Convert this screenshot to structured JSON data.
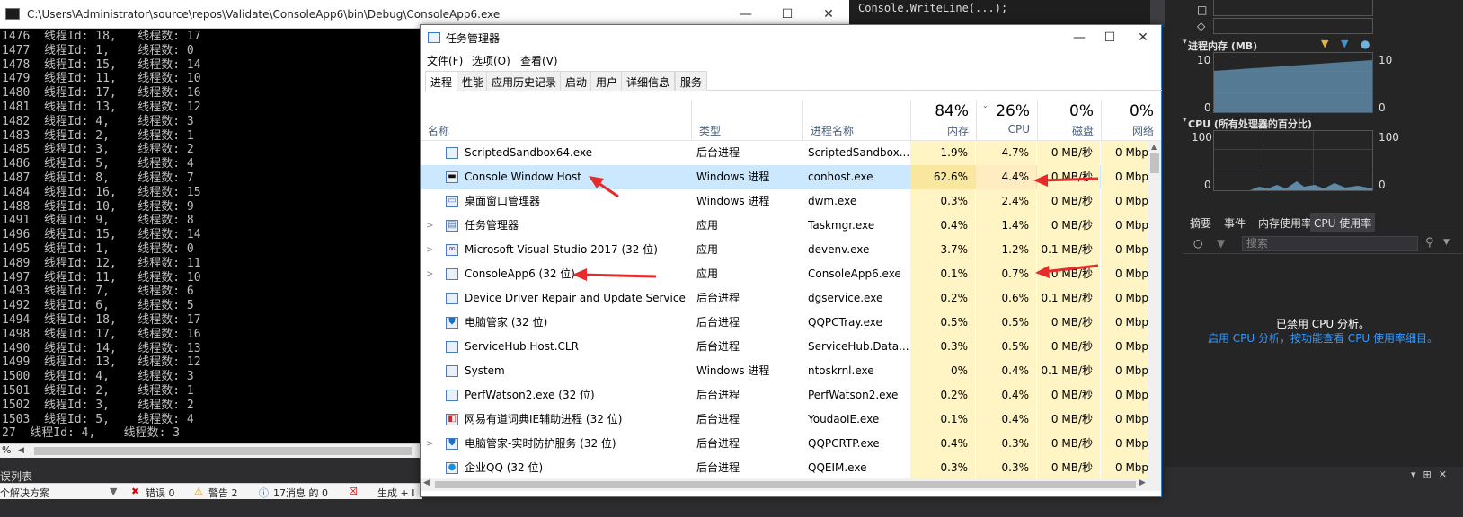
{
  "ide": {
    "top_code_fragment": "Console.WriteLine(...);",
    "error_list_title": "误列表",
    "errbar": {
      "solution": "个解决方案",
      "errors": "错误 0",
      "warnings": "警告 2",
      "messages": "17消息 的 0",
      "build": "生成 + I"
    }
  },
  "console": {
    "title": "C:\\Users\\Administrator\\source\\repos\\Validate\\ConsoleApp6\\bin\\Debug\\ConsoleApp6.exe",
    "lines": [
      "1476  线程Id: 18,   线程数: 17",
      "1477  线程Id: 1,    线程数: 0",
      "1478  线程Id: 15,   线程数: 14",
      "1479  线程Id: 11,   线程数: 10",
      "1480  线程Id: 17,   线程数: 16",
      "1481  线程Id: 13,   线程数: 12",
      "1482  线程Id: 4,    线程数: 3",
      "1483  线程Id: 2,    线程数: 1",
      "1485  线程Id: 3,    线程数: 2",
      "1486  线程Id: 5,    线程数: 4",
      "1487  线程Id: 8,    线程数: 7",
      "1484  线程Id: 16,   线程数: 15",
      "1488  线程Id: 10,   线程数: 9",
      "1491  线程Id: 9,    线程数: 8",
      "1496  线程Id: 15,   线程数: 14",
      "1495  线程Id: 1,    线程数: 0",
      "1489  线程Id: 12,   线程数: 11",
      "1497  线程Id: 11,   线程数: 10",
      "1493  线程Id: 7,    线程数: 6",
      "1492  线程Id: 6,    线程数: 5",
      "1494  线程Id: 18,   线程数: 17",
      "1498  线程Id: 17,   线程数: 16",
      "1490  线程Id: 14,   线程数: 13",
      "1499  线程Id: 13,   线程数: 12",
      "1500  线程Id: 4,    线程数: 3",
      "1501  线程Id: 2,    线程数: 1",
      "1502  线程Id: 3,    线程数: 2",
      "1503  线程Id: 5,    线程数: 4",
      "27  线程Id: 4,    线程数: 3"
    ],
    "scroll_pct": "%"
  },
  "taskmgr": {
    "title": "任务管理器",
    "menu": [
      "文件(F)",
      "选项(O)",
      "查看(V)"
    ],
    "tabs": [
      "进程",
      "性能",
      "应用历史记录",
      "启动",
      "用户",
      "详细信息",
      "服务"
    ],
    "headers": {
      "name": "名称",
      "type": "类型",
      "procname": "进程名称",
      "mem_pct": "84%",
      "mem": "内存",
      "cpu_pct": "26%",
      "cpu": "CPU",
      "disk_pct": "0%",
      "disk": "磁盘",
      "net_pct": "0%",
      "net": "网络"
    },
    "rows": [
      {
        "exp": "",
        "icon": "app-window-icon",
        "name": "ScriptedSandbox64.exe",
        "type": "后台进程",
        "proc": "ScriptedSandbox...",
        "mem": "1.9%",
        "cpu": "4.7%",
        "disk": "0 MB/秒",
        "net": "0 Mbp"
      },
      {
        "exp": "",
        "icon": "console-icon",
        "name": "Console Window Host",
        "type": "Windows 进程",
        "proc": "conhost.exe",
        "mem": "62.6%",
        "cpu": "4.4%",
        "disk": "0 MB/秒",
        "net": "0 Mbp"
      },
      {
        "exp": "",
        "icon": "desktop-window-icon",
        "name": "桌面窗口管理器",
        "type": "Windows 进程",
        "proc": "dwm.exe",
        "mem": "0.3%",
        "cpu": "2.4%",
        "disk": "0 MB/秒",
        "net": "0 Mbp"
      },
      {
        "exp": ">",
        "icon": "task-manager-icon",
        "name": "任务管理器",
        "type": "应用",
        "proc": "Taskmgr.exe",
        "mem": "0.4%",
        "cpu": "1.4%",
        "disk": "0 MB/秒",
        "net": "0 Mbp"
      },
      {
        "exp": ">",
        "icon": "visual-studio-icon",
        "name": "Microsoft Visual Studio 2017 (32 位)",
        "type": "应用",
        "proc": "devenv.exe",
        "mem": "3.7%",
        "cpu": "1.2%",
        "disk": "0.1 MB/秒",
        "net": "0 Mbp"
      },
      {
        "exp": ">",
        "icon": "app-window-icon",
        "name": "ConsoleApp6 (32 位)",
        "type": "应用",
        "proc": "ConsoleApp6.exe",
        "mem": "0.1%",
        "cpu": "0.7%",
        "disk": "0 MB/秒",
        "net": "0 Mbp"
      },
      {
        "exp": "",
        "icon": "app-window-icon",
        "name": "Device Driver Repair and Update Service (...",
        "type": "后台进程",
        "proc": "dgservice.exe",
        "mem": "0.2%",
        "cpu": "0.6%",
        "disk": "0.1 MB/秒",
        "net": "0 Mbp"
      },
      {
        "exp": "",
        "icon": "shield-icon",
        "name": "电脑管家 (32 位)",
        "type": "后台进程",
        "proc": "QQPCTray.exe",
        "mem": "0.5%",
        "cpu": "0.5%",
        "disk": "0 MB/秒",
        "net": "0 Mbp"
      },
      {
        "exp": "",
        "icon": "app-window-icon",
        "name": "ServiceHub.Host.CLR",
        "type": "后台进程",
        "proc": "ServiceHub.Data...",
        "mem": "0.3%",
        "cpu": "0.5%",
        "disk": "0 MB/秒",
        "net": "0 Mbp"
      },
      {
        "exp": "",
        "icon": "app-window-icon",
        "name": "System",
        "type": "Windows 进程",
        "proc": "ntoskrnl.exe",
        "mem": "0%",
        "cpu": "0.4%",
        "disk": "0.1 MB/秒",
        "net": "0 Mbp"
      },
      {
        "exp": "",
        "icon": "app-window-icon",
        "name": "PerfWatson2.exe (32 位)",
        "type": "后台进程",
        "proc": "PerfWatson2.exe",
        "mem": "0.2%",
        "cpu": "0.4%",
        "disk": "0 MB/秒",
        "net": "0 Mbp"
      },
      {
        "exp": "",
        "icon": "dictionary-icon",
        "name": "网易有道词典IE辅助进程 (32 位)",
        "type": "后台进程",
        "proc": "YoudaoIE.exe",
        "mem": "0.1%",
        "cpu": "0.4%",
        "disk": "0 MB/秒",
        "net": "0 Mbp"
      },
      {
        "exp": ">",
        "icon": "shield-icon",
        "name": "电脑管家-实时防护服务 (32 位)",
        "type": "后台进程",
        "proc": "QQPCRTP.exe",
        "mem": "0.4%",
        "cpu": "0.3%",
        "disk": "0 MB/秒",
        "net": "0 Mbp"
      },
      {
        "exp": "",
        "icon": "qq-icon",
        "name": "企业QQ (32 位)",
        "type": "后台进程",
        "proc": "QQEIM.exe",
        "mem": "0.3%",
        "cpu": "0.3%",
        "disk": "0 MB/秒",
        "net": "0 Mbp"
      }
    ]
  },
  "diag": {
    "memory_title": "进程内存 (MB)",
    "memory_ymax_left": "10",
    "memory_ymax_right": "10",
    "memory_ymin_left": "0",
    "memory_ymin_right": "0",
    "cpu_title": "CPU (所有处理器的百分比)",
    "cpu_ymax_left": "100",
    "cpu_ymax_right": "100",
    "cpu_ymin_left": "0",
    "cpu_ymin_right": "0",
    "tabs": [
      "摘要",
      "事件",
      "内存使用率",
      "CPU 使用率"
    ],
    "search_placeholder": "搜索",
    "msg_disabled": "已禁用 CPU 分析。",
    "msg_enable": "启用 CPU 分析，按功能查看 CPU 使用率细目。"
  }
}
